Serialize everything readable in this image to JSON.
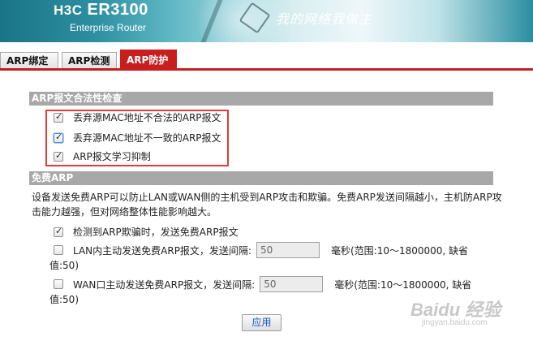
{
  "header": {
    "brand": "H3C",
    "model": "ER3100",
    "subtitle": "Enterprise Router",
    "slogan": "我的网络我做主"
  },
  "tabs": [
    {
      "label": "ARP绑定",
      "active": false
    },
    {
      "label": "ARP检测",
      "active": false
    },
    {
      "label": "ARP防护",
      "active": true
    }
  ],
  "section_validity": {
    "title": "ARP报文合法性检查",
    "options": [
      {
        "label": "丢弃源MAC地址不合法的ARP报文",
        "checked": true
      },
      {
        "label": "丢弃源MAC地址不一致的ARP报文",
        "checked": true
      },
      {
        "label": "ARP报文学习抑制",
        "checked": true
      }
    ]
  },
  "section_gratuitous": {
    "title": "免费ARP",
    "description": "设备发送免费ARP可以防止LAN或WAN侧的主机受到ARP攻击和欺骗。免费ARP发送间隔越小，主机防ARP攻击能力越强，但对网络整体性能影响越大。",
    "detect_option": {
      "label": "检测到ARP欺骗时，发送免费ARP报文",
      "checked": true
    },
    "lan_option": {
      "label": "LAN内主动发送免费ARP报文，发送间隔:",
      "checked": false,
      "value": "50",
      "unit": "毫秒(范围:10～1800000, 缺省",
      "unit_wrap": "值:50)"
    },
    "wan_option": {
      "label": "WAN口主动发送免费ARP报文，发送间隔:",
      "checked": false,
      "value": "50",
      "unit": "毫秒(范围:10～1800000, 缺省",
      "unit_wrap": "值:50)"
    }
  },
  "apply_label": "应用",
  "watermark": {
    "text": "Baidu 经验",
    "sub": "jingyan.baidu.com"
  }
}
